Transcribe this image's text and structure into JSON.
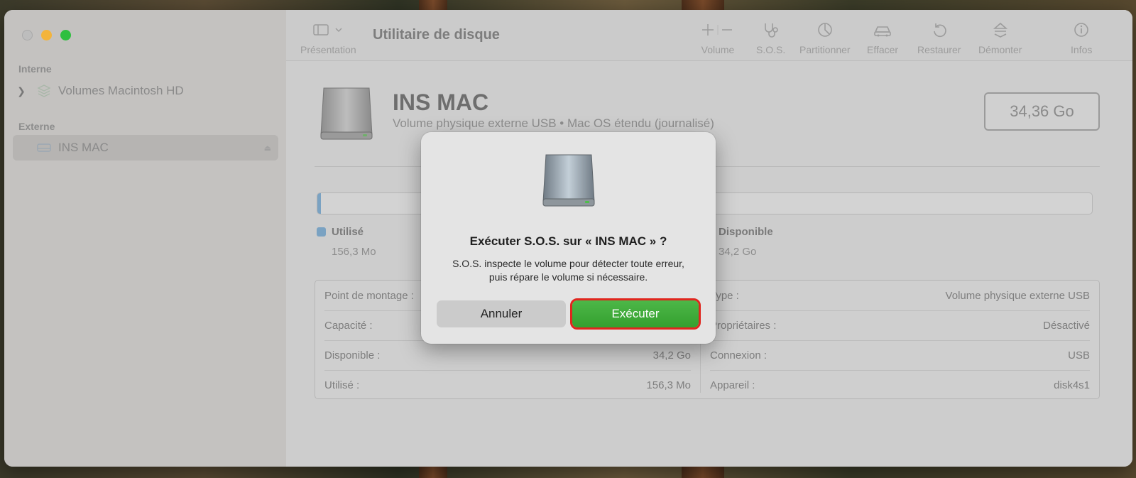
{
  "window": {
    "title": "Utilitaire de disque"
  },
  "sidebar": {
    "section_internal": "Interne",
    "section_external": "Externe",
    "items": [
      {
        "label": "Volumes Macintosh HD",
        "icon": "layers-icon"
      },
      {
        "label": "INS MAC",
        "icon": "external-drive-icon",
        "selected": true
      }
    ]
  },
  "toolbar": {
    "view_label": "Présentation",
    "volume_label": "Volume",
    "firstaid_label": "S.O.S.",
    "partition_label": "Partitionner",
    "erase_label": "Effacer",
    "restore_label": "Restaurer",
    "unmount_label": "Démonter",
    "info_label": "Infos"
  },
  "volume": {
    "name": "INS MAC",
    "subtitle": "Volume physique externe USB • Mac OS étendu (journalisé)",
    "size": "34,36 Go",
    "used_fraction": 0.005,
    "used_label": "Utilisé",
    "used_value": "156,3 Mo",
    "free_label": "Disponible",
    "free_value": "34,2 Go",
    "used_color": "#7aa2c2"
  },
  "info": {
    "left": [
      {
        "key": "Point de montage :",
        "value": ""
      },
      {
        "key": "Capacité :",
        "value": ""
      },
      {
        "key": "Disponible :",
        "value": "34,2 Go"
      },
      {
        "key": "Utilisé :",
        "value": "156,3 Mo"
      }
    ],
    "right": [
      {
        "key": "Type :",
        "value": "Volume physique externe USB"
      },
      {
        "key": "Propriétaires :",
        "value": "Désactivé"
      },
      {
        "key": "Connexion :",
        "value": "USB"
      },
      {
        "key": "Appareil :",
        "value": "disk4s1"
      }
    ]
  },
  "dialog": {
    "title": "Exécuter S.O.S. sur « INS MAC » ?",
    "message": "S.O.S. inspecte le volume pour détecter toute erreur, puis répare le volume si nécessaire.",
    "cancel_label": "Annuler",
    "run_label": "Exécuter",
    "run_color": "#3aa634",
    "highlight_color": "#e0261e"
  }
}
